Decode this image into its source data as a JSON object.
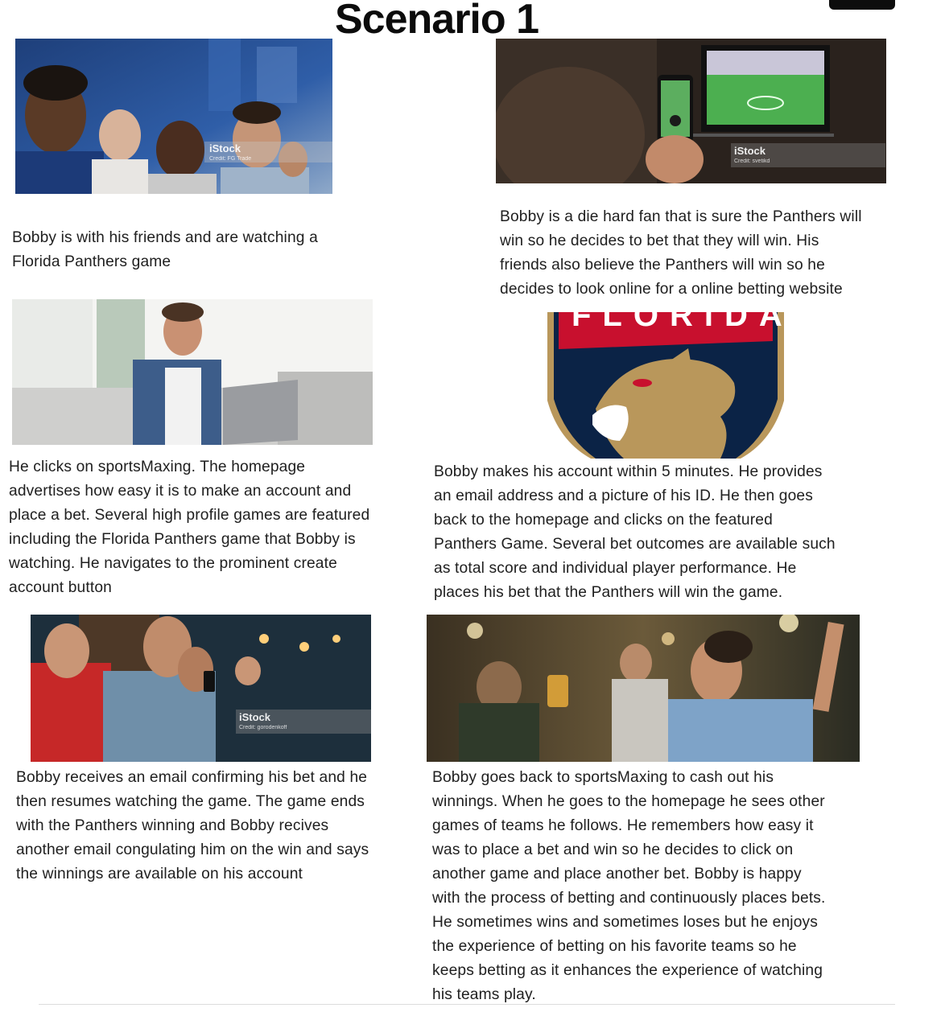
{
  "title": "Scenario 1",
  "watermarks": {
    "brand": "iStock",
    "credit_1": "Credit: FG Trade",
    "credit_2": "Credit: svetikd",
    "credit_3": "Credit: gorodenkoff"
  },
  "logo_text": "FLORIDA",
  "captions": {
    "c1": "Bobby is with his friends and are watching a\nFlorida Panthers game",
    "c2": "Bobby is a die hard fan that is sure the Panthers will\nwin so he decides to bet that they will win. His\nfriends also believe the Panthers will win so he\ndecides to look online for a online betting website",
    "c3": "He clicks on sportsMaxing. The homepage\nadvertises how easy it is to make an account and\nplace a bet. Several high profile games are featured\nincluding the Florida Panthers game that Bobby is\nwatching. He navigates to the prominent create\naccount button",
    "c4": "Bobby makes his account within 5 minutes. He provides\nan email address and a picture of his ID. He then goes\nback to the homepage and clicks on the featured\nPanthers Game. Several bet outcomes are available such\nas total score and individual player performance. He\nplaces his bet that the Panthers will win the game.",
    "c5": "Bobby receives an email confirming his bet and he\nthen resumes watching the game. The game ends\nwith the Panthers winning and Bobby recives\nanother email congulating him on the win and says\nthe winnings are available on his account",
    "c6": "Bobby goes back to sportsMaxing to cash out his\nwinnings. When he goes to the homepage he sees other\ngames of teams he follows. He remembers how easy it\nwas to place a bet and win so he decides to click on\nanother game and place another bet. Bobby is happy\nwith the process of betting and continuously places bets.\nHe sometimes wins and sometimes loses but he enjoys\nthe experience of betting on his favorite teams so he\nkeeps betting as it enhances the experience of watching\nhis teams play."
  },
  "colors": {
    "panthers_navy": "#0b2346",
    "panthers_red": "#c8102e",
    "panthers_gold": "#b9975b"
  }
}
